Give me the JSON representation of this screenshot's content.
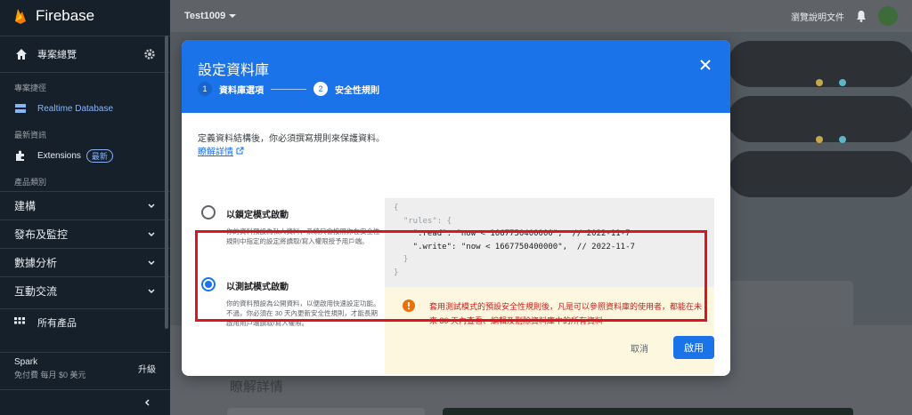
{
  "app": {
    "brand": "Firebase"
  },
  "sidebar": {
    "project_overview": "專案總覽",
    "sections": {
      "shortcuts": "專案捷徑",
      "whats_new": "最新資訊",
      "categories": "產品類別"
    },
    "items": [
      {
        "label": "Realtime Database",
        "icon": "database-icon",
        "active": true
      },
      {
        "label": "Extensions",
        "icon": "extensions-icon",
        "badge": "最新"
      }
    ],
    "groups": [
      "建構",
      "發布及監控",
      "數據分析",
      "互動交流"
    ],
    "all_products": "所有產品",
    "plan": {
      "name": "Spark",
      "price": "免付費 每月 $0 美元",
      "upgrade": "升級"
    }
  },
  "topbar": {
    "project": "Test1009",
    "docs": "瀏覽說明文件"
  },
  "background": {
    "learn_more_heading": "瞭解詳情"
  },
  "dialog": {
    "title": "設定資料庫",
    "steps": [
      {
        "num": "1",
        "label": "資料庫選項"
      },
      {
        "num": "2",
        "label": "安全性規則"
      }
    ],
    "intro": "定義資料結構後，你必須撰寫規則來保護資料。",
    "learn_link": "瞭解詳情",
    "options": [
      {
        "title": "以鎖定模式啟動",
        "desc": "你的資料預設為私人資料，系統只會按照你在安全性規則中指定的設定將讀取/寫入權限授予用戶端。",
        "selected": false
      },
      {
        "title": "以測試模式啟動",
        "desc": "你的資料預設為公開資料，以便啟用快速設定功能。不過，你必須在 30 天內更新安全性規則，才能長期啟用用戶端讀取/寫入權限。",
        "selected": true
      }
    ],
    "code_lines": [
      "{",
      "  \"rules\": {",
      "    \".read\": \"now < 1667750400000\",  // 2022-11-7",
      "    \".write\": \"now < 1667750400000\",  // 2022-11-7",
      "  }",
      "}"
    ],
    "warning": "套用測試模式的預設安全性規則後，凡是可以參照資料庫的使用者，都能在未來 30 天內查看、編輯及刪除資料庫中的所有資料",
    "cancel": "取消",
    "enable": "啟用"
  },
  "colors": {
    "accent": "#1a73e8",
    "sidebar_bg": "#15202b",
    "warning_text": "#c5221f",
    "highlight": "#e0141e"
  }
}
